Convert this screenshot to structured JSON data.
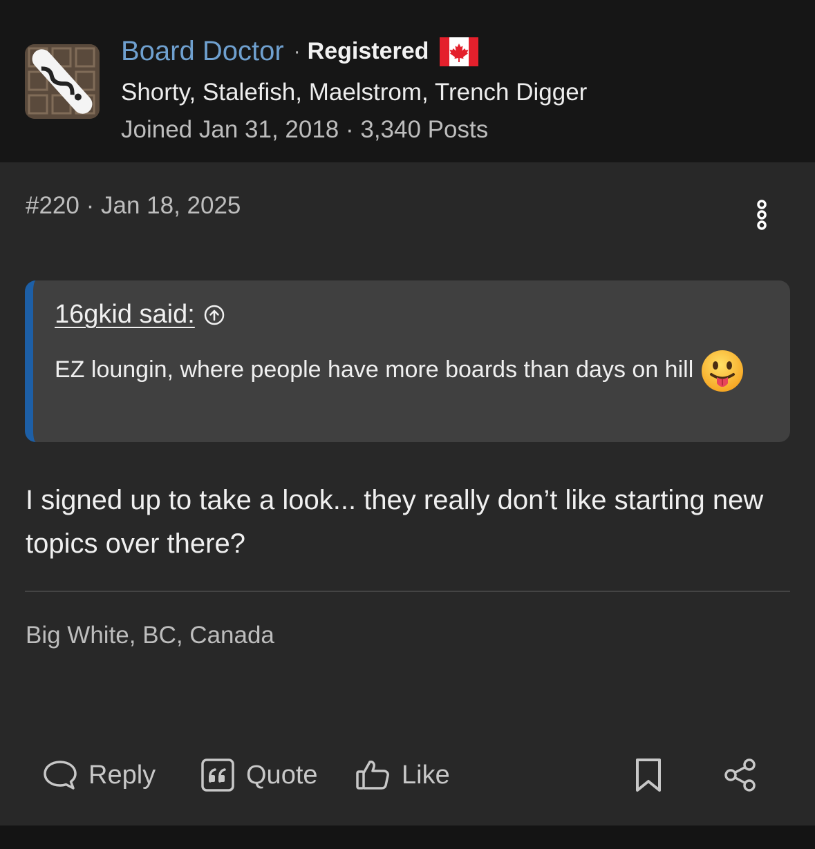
{
  "author": {
    "name": "Board Doctor",
    "separator": "·",
    "role": "Registered",
    "flag": "canada-flag",
    "title": "Shorty, Stalefish, Maelstrom, Trench Digger",
    "meta": "Joined Jan 31, 2018 · 3,340 Posts"
  },
  "post": {
    "number": "#220",
    "separator": "·",
    "date": "Jan 18, 2025",
    "quote": {
      "author": "16gkid said:",
      "text": "EZ loungin, where people have more boards than days on hill",
      "emoji": "face-with-tongue"
    },
    "body": "I signed up to take a look... they really don’t like starting new topics over there?",
    "signature": "Big White, BC, Canada"
  },
  "actions": {
    "reply": "Reply",
    "quote": "Quote",
    "like": "Like"
  },
  "colors": {
    "username": "#6fa0cf",
    "quote_bar": "#1d5fa6",
    "post_bg": "#282828",
    "header_bg": "#161616"
  }
}
